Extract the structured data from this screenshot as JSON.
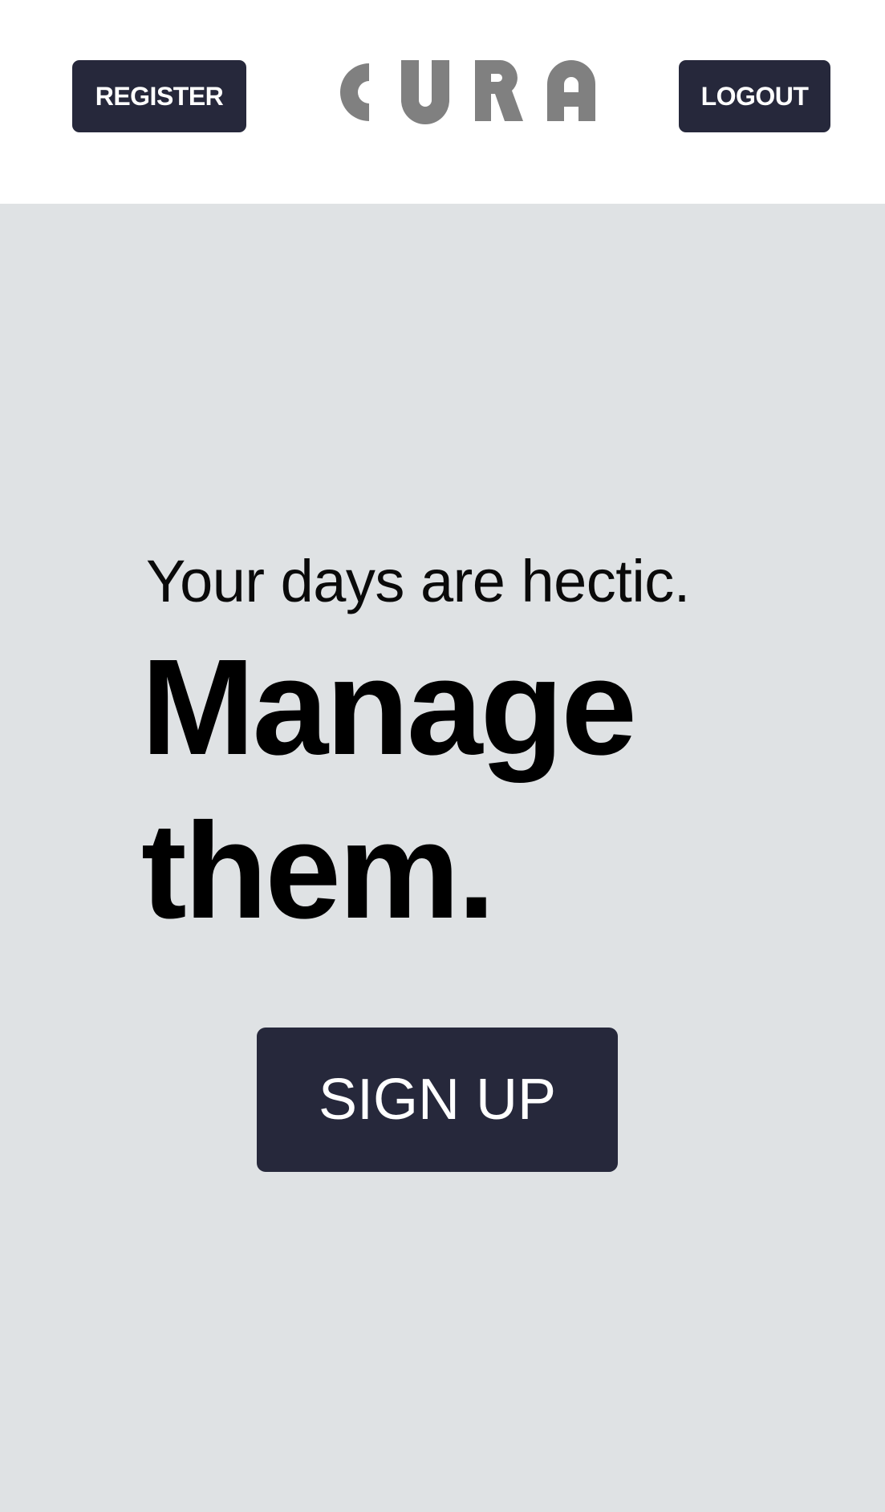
{
  "header": {
    "register_label": "REGISTER",
    "logout_label": "LOGOUT",
    "logo_text": "CURA",
    "logo_color": "#808080",
    "button_color": "#26283b"
  },
  "hero": {
    "tagline": "Your days are hectic.",
    "headline": "Manage them.",
    "signup_label": "SIGN UP",
    "background_color": "#dfe2e4"
  }
}
